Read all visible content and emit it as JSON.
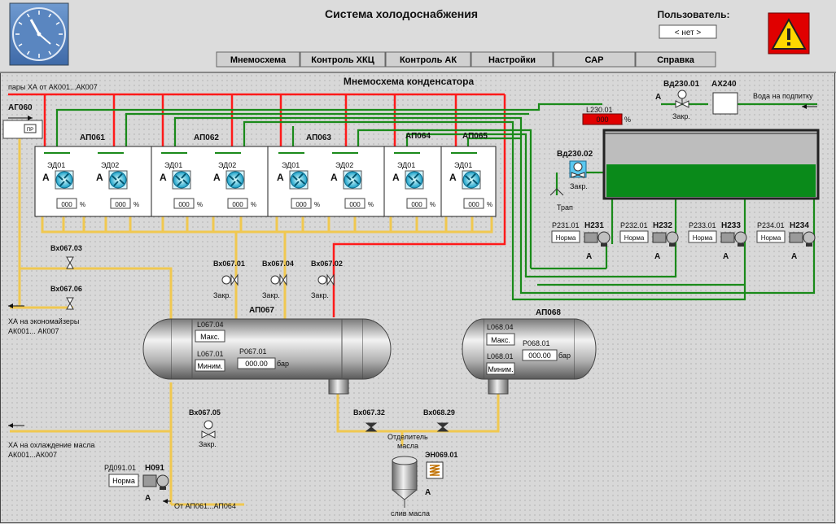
{
  "header": {
    "title": "Система холодоснабжения",
    "user_label": "Пользователь:",
    "user_value": "< нет >"
  },
  "nav": {
    "tabs": [
      "Мнемосхема",
      "Контроль ХКЦ",
      "Контроль АК",
      "Настройки",
      "САР",
      "Справка"
    ]
  },
  "scheme": {
    "title": "Мнемосхема конденсатора",
    "vapor_label": "пары ХА от АК001...АК007",
    "ag060": "АГ060",
    "ag060_value": "ПР",
    "water_label": "Вода на подпитку",
    "condensers": [
      "АП061",
      "АП062",
      "АП063",
      "АП064",
      "АП065"
    ],
    "fan_labels": [
      "ЭД01",
      "ЭД02",
      "ЭД01",
      "ЭД02",
      "ЭД01",
      "ЭД02",
      "ЭД01",
      "ЭД01"
    ],
    "fan_value": "000",
    "percent": "%",
    "mode_a": "А",
    "l230": "L230.01",
    "l230_value": "000",
    "vd230_01": "Вд230.01",
    "ax240": "АХ240",
    "vd230_02": "Вд230.02",
    "closed": "Закр.",
    "trap": "Трап",
    "pumps": [
      {
        "p": "Р231.01",
        "h": "Н231",
        "status": "Норма"
      },
      {
        "p": "Р232.01",
        "h": "Н232",
        "status": "Норма"
      },
      {
        "p": "Р233.01",
        "h": "Н233",
        "status": "Норма"
      },
      {
        "p": "Р234.01",
        "h": "Н234",
        "status": "Норма"
      }
    ],
    "vx067_03": "Вх067.03",
    "vx067_06": "Вх067.06",
    "vx067_01": "Вх067.01",
    "vx067_04": "Вх067.04",
    "vx067_02": "Вх067.02",
    "vx067_05": "Вх067.05",
    "vx067_32": "Вх067.32",
    "vx068_29": "Вх068.29",
    "economizers_1": "ХА на экономайзеры",
    "economizers_2": "АК001... АК007",
    "oil_cool_1": "ХА на охлаждение масла",
    "oil_cool_2": "АК001...АК007",
    "ap067": "АП067",
    "ap068": "АП068",
    "l067_04": "L067.04",
    "l067_01": "L067.01",
    "p067_01": "Р067.01",
    "l068_04": "L068.04",
    "l068_01": "L068.01",
    "p068_01": "Р068.01",
    "max": "Макс.",
    "min": "Миним.",
    "pressure_value": "000.00",
    "bar": "бар",
    "separator_1": "Отделитель",
    "separator_2": "масла",
    "eh069": "ЭН069.01",
    "oil_drain": "слив масла",
    "pd091": "РД091.01",
    "h091": "Н091",
    "norma": "Норма",
    "from_ap": "От АП061...АП064"
  },
  "colors": {
    "background": "#d4d4d4",
    "red_line": "#ff1a1a",
    "green_line": "#1a8a1a",
    "yellow_line": "#f0c850",
    "water_level": "#0a8a1a",
    "alarm": "#e00000"
  }
}
